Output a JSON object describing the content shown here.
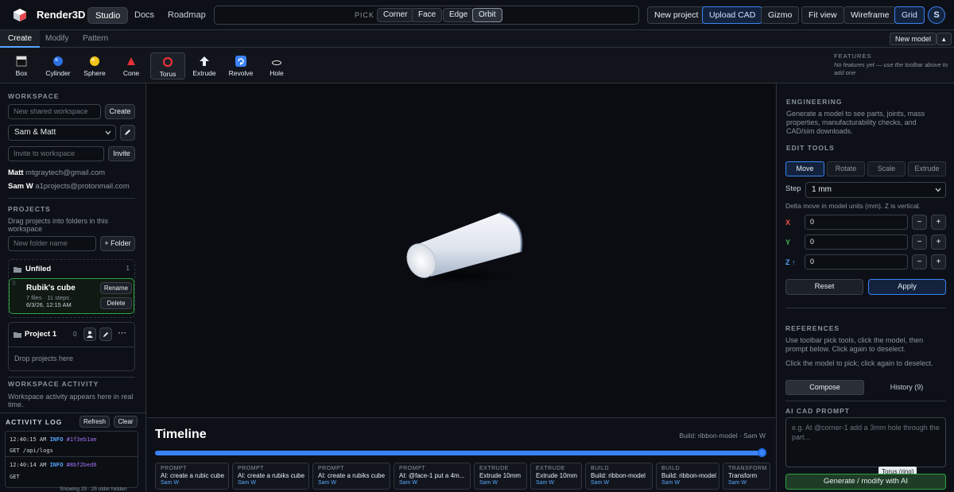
{
  "header": {
    "brand": "Render3D",
    "nav": [
      "Studio",
      "Docs",
      "Roadmap"
    ],
    "pick_label": "PICK",
    "pick_modes": [
      "Corner",
      "Face",
      "Edge",
      "Orbit"
    ],
    "actions": [
      "New project",
      "Upload CAD",
      "Gizmo",
      "Fit view",
      "Wireframe",
      "Grid"
    ],
    "avatar_initial": "S"
  },
  "tabs": [
    "Create",
    "Modify",
    "Pattern"
  ],
  "new_model_label": "New model",
  "collapse_label": "▴",
  "tools": [
    "Box",
    "Cylinder",
    "Sphere",
    "Cone",
    "Torus",
    "Extrude",
    "Revolve",
    "Hole"
  ],
  "features": {
    "title": "FEATURES",
    "empty_text": "No features yet — use the toolbar above to add one"
  },
  "workspace": {
    "title": "WORKSPACE",
    "new_placeholder": "New shared workspace",
    "create_label": "Create",
    "selected": "Sam & Matt",
    "invite_placeholder": "Invite to workspace",
    "invite_label": "Invite",
    "members": [
      {
        "name": "Matt",
        "email": "mtgraytech@gmail.com"
      },
      {
        "name": "Sam W",
        "email": "a1projects@protonmail.com"
      }
    ]
  },
  "projects": {
    "title": "PROJECTS",
    "hint": "Drag projects into folders in this workspace",
    "folder_placeholder": "New folder name",
    "add_folder_label": "+ Folder",
    "unfiled": {
      "name": "Unfiled",
      "count": "1"
    },
    "project_item": {
      "name": "Rubik's cube",
      "meta1": "7 files · 11 steps ·",
      "meta2": "6/3/26, 12:15 AM",
      "rename": "Rename",
      "delete": "Delete"
    },
    "project1": {
      "name": "Project 1",
      "count": "0",
      "drop_hint": "Drop projects here"
    }
  },
  "workspace_activity": {
    "title": "WORKSPACE ACTIVITY",
    "text": "Workspace activity appears here in real time."
  },
  "activity_log": {
    "title": "ACTIVITY LOG",
    "refresh": "Refresh",
    "clear": "Clear",
    "entries": [
      {
        "time": "12:40:15 AM",
        "level": "INFO",
        "id": "#1f3eb1ae",
        "msg": "GET /api/logs"
      },
      {
        "time": "12:40:14 AM",
        "level": "INFO",
        "id": "#8bf2bed6",
        "msg": "GET"
      }
    ],
    "footer": "Showing 25 · 25 older hidden"
  },
  "timeline": {
    "title": "Timeline",
    "meta": "Build: ribbon-model · Sam W",
    "progress": 1.0,
    "cards": [
      {
        "kind": "PROMPT",
        "text": "AI: create a rubic cube",
        "user": "Sam W"
      },
      {
        "kind": "PROMPT",
        "text": "AI: create a rubiks cube",
        "user": "Sam W"
      },
      {
        "kind": "PROMPT",
        "text": "AI: create a rubiks cube",
        "user": "Sam W"
      },
      {
        "kind": "PROMPT",
        "text": "AI: @face-1 put a 4m...",
        "user": "Sam W"
      },
      {
        "kind": "EXTRUDE",
        "text": "Extrude 10mm",
        "user": "Sam W"
      },
      {
        "kind": "EXTRUDE",
        "text": "Extrude 10mm",
        "user": "Sam W"
      },
      {
        "kind": "BUILD",
        "text": "Build: ribbon-model",
        "user": "Sam W"
      },
      {
        "kind": "BUILD",
        "text": "Build: ribbon-model",
        "user": "Sam W"
      },
      {
        "kind": "TRANSFORM",
        "text": "Transform",
        "user": "Sam W"
      }
    ]
  },
  "engineering": {
    "title": "ENGINEERING",
    "text": "Generate a model to see parts, joints, mass properties, manufacturability checks, and CAD/sim downloads."
  },
  "edit_tools": {
    "title": "EDIT TOOLS",
    "modes": [
      "Move",
      "Rotate",
      "Scale",
      "Extrude"
    ],
    "step_label": "Step",
    "step_value": "1 mm",
    "hint": "Delta move in model units (mm). Z is vertical.",
    "axes": [
      {
        "label": "X",
        "value": "0",
        "color": "#f85149"
      },
      {
        "label": "Y",
        "value": "0",
        "color": "#3fb950"
      },
      {
        "label": "Z ↑",
        "value": "0",
        "color": "#58a6ff"
      }
    ],
    "minus": "−",
    "plus": "+",
    "reset": "Reset",
    "apply": "Apply"
  },
  "references": {
    "title": "REFERENCES",
    "text1": "Use toolbar pick tools, click the model, then prompt below. Click again to deselect.",
    "text2": "Click the model to pick; click again to deselect."
  },
  "compose_tabs": [
    "Compose",
    "History (9)"
  ],
  "ai_prompt": {
    "title": "AI CAD PROMPT",
    "placeholder": "e.g. At @corner-1 add a 3mm hole through the part...",
    "tooltip": "Torus (ring)",
    "generate": "Generate / modify with AI"
  }
}
